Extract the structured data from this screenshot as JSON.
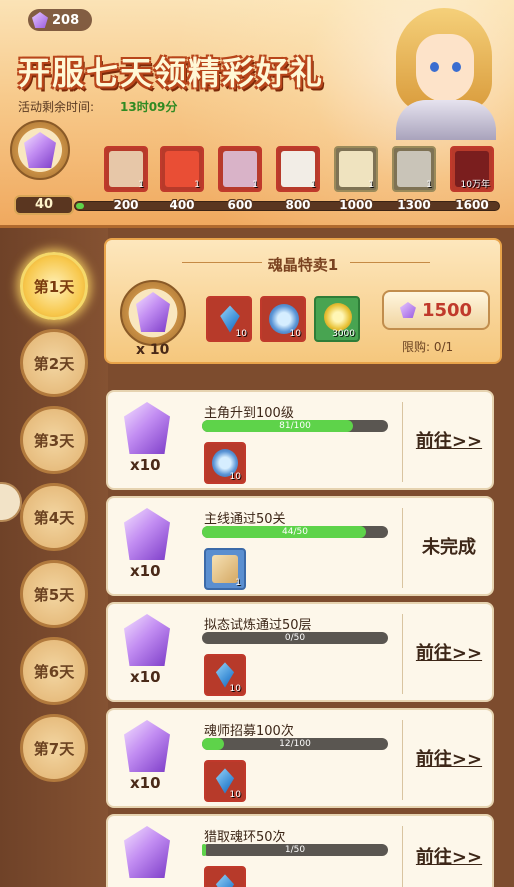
{
  "header": {
    "currency_value": "208",
    "title": "开服七天领精彩好礼",
    "timer_label": "活动剩余时间:",
    "timer_value": "13时09分",
    "current_points": "40",
    "progress_fraction": 0.02,
    "milestones": [
      {
        "label": "200",
        "icon": "hero-portrait-icon",
        "qty": "1"
      },
      {
        "label": "400",
        "icon": "gift-box-icon",
        "qty": "1"
      },
      {
        "label": "600",
        "icon": "hero-portrait-icon",
        "qty": "1"
      },
      {
        "label": "800",
        "icon": "hero-portrait-icon",
        "qty": "1"
      },
      {
        "label": "1000",
        "icon": "treasure-chest-icon",
        "qty": "1"
      },
      {
        "label": "1300",
        "icon": "weapon-bundle-icon",
        "qty": "1"
      },
      {
        "label": "1600",
        "icon": "demon-emblem-icon",
        "qty": "10万年"
      }
    ]
  },
  "days": [
    "第1天",
    "第2天",
    "第3天",
    "第4天",
    "第5天",
    "第6天",
    "第7天"
  ],
  "active_day_index": 0,
  "offer": {
    "title": "魂晶特卖1",
    "main_qty": "x 10",
    "items": [
      {
        "icon": "blue-crystal-icon",
        "qty": "10"
      },
      {
        "icon": "blue-ring-icon",
        "qty": "10"
      },
      {
        "icon": "gold-coin-icon",
        "qty": "3000"
      }
    ],
    "price": "1500",
    "limit": "限购: 0/1"
  },
  "tasks": [
    {
      "name": "主角升到100级",
      "progress_text": "81/100",
      "progress": 0.81,
      "reward_qty": "10",
      "reward_icon": "blue-ring-icon",
      "gem_qty": "x10",
      "action": "前往>>",
      "action_type": "link"
    },
    {
      "name": "主线通过50关",
      "progress_text": "44/50",
      "progress": 0.88,
      "reward_qty": "1",
      "reward_icon": "scroll-icon",
      "gem_qty": "x10",
      "action": "未完成",
      "action_type": "status"
    },
    {
      "name": "拟态试炼通过50层",
      "progress_text": "0/50",
      "progress": 0.0,
      "reward_qty": "10",
      "reward_icon": "blue-crystal-icon",
      "gem_qty": "x10",
      "action": "前往>>",
      "action_type": "link"
    },
    {
      "name": "魂师招募100次",
      "progress_text": "12/100",
      "progress": 0.12,
      "reward_qty": "10",
      "reward_icon": "blue-crystal-icon",
      "gem_qty": "x10",
      "action": "前往>>",
      "action_type": "link"
    },
    {
      "name": "猎取魂环50次",
      "progress_text": "1/50",
      "progress": 0.02,
      "reward_qty": "",
      "reward_icon": "blue-crystal-icon",
      "gem_qty": "",
      "action": "前往>>",
      "action_type": "link"
    }
  ]
}
